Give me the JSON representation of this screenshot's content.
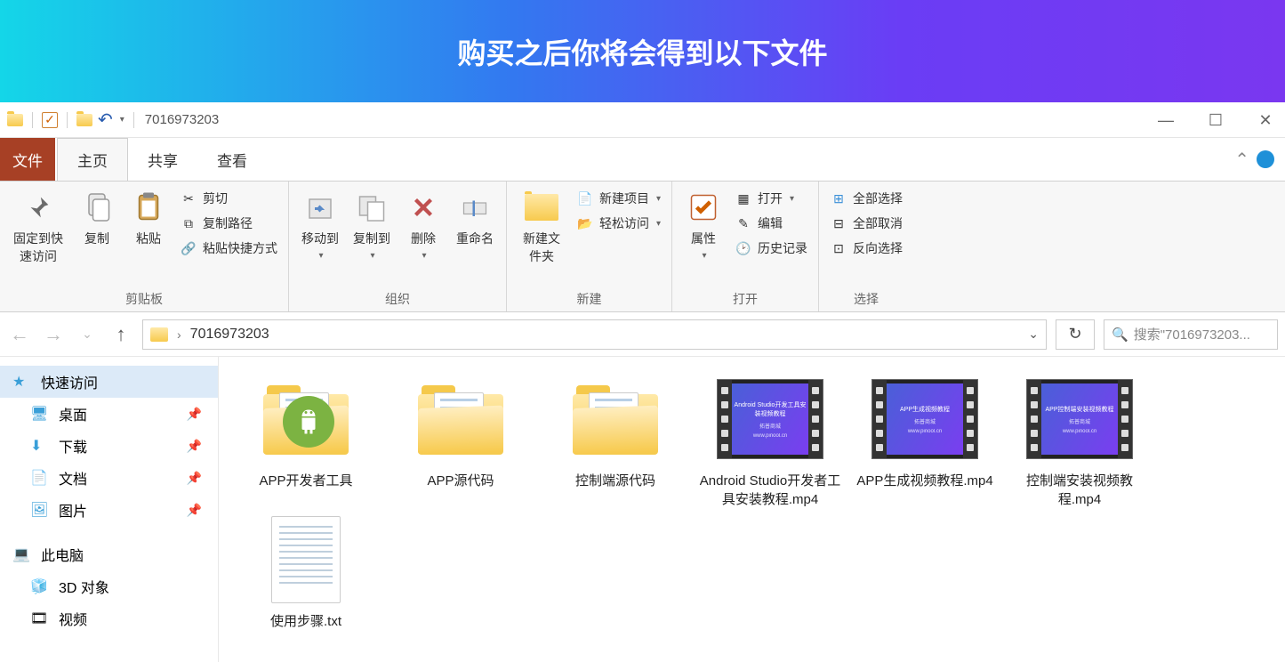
{
  "banner": {
    "title": "购买之后你将会得到以下文件"
  },
  "titlebar": {
    "path": "7016973203"
  },
  "tabs": {
    "file": "文件",
    "home": "主页",
    "share": "共享",
    "view": "查看"
  },
  "ribbon": {
    "clipboard": {
      "pin": "固定到快速访问",
      "copy": "复制",
      "paste": "粘贴",
      "cut": "剪切",
      "copyPath": "复制路径",
      "pasteShortcut": "粘贴快捷方式",
      "label": "剪贴板"
    },
    "organize": {
      "moveTo": "移动到",
      "copyTo": "复制到",
      "delete": "删除",
      "rename": "重命名",
      "label": "组织"
    },
    "new": {
      "newFolder": "新建文件夹",
      "newItem": "新建项目",
      "easyAccess": "轻松访问",
      "label": "新建"
    },
    "open": {
      "properties": "属性",
      "open": "打开",
      "edit": "编辑",
      "history": "历史记录",
      "label": "打开"
    },
    "select": {
      "all": "全部选择",
      "none": "全部取消",
      "invert": "反向选择",
      "label": "选择"
    }
  },
  "address": {
    "crumb": "7016973203",
    "searchPlaceholder": "搜索\"7016973203..."
  },
  "sidebar": {
    "quick": "快速访问",
    "desktop": "桌面",
    "downloads": "下载",
    "documents": "文档",
    "pictures": "图片",
    "thispc": "此电脑",
    "objects3d": "3D 对象",
    "videos": "视频"
  },
  "files": [
    {
      "name": "APP开发者工具",
      "type": "folder-android"
    },
    {
      "name": "APP源代码",
      "type": "folder"
    },
    {
      "name": "控制端源代码",
      "type": "folder"
    },
    {
      "name": "Android Studio开发者工具安装教程.mp4",
      "type": "video",
      "caption": "Android Studio开发工具安装视频教程"
    },
    {
      "name": "APP生成视频教程.mp4",
      "type": "video",
      "caption": "APP生成视频教程"
    },
    {
      "name": "控制端安装视频教程.mp4",
      "type": "video",
      "caption": "APP控制端安装视频教程"
    },
    {
      "name": "使用步骤.txt",
      "type": "txt"
    }
  ]
}
